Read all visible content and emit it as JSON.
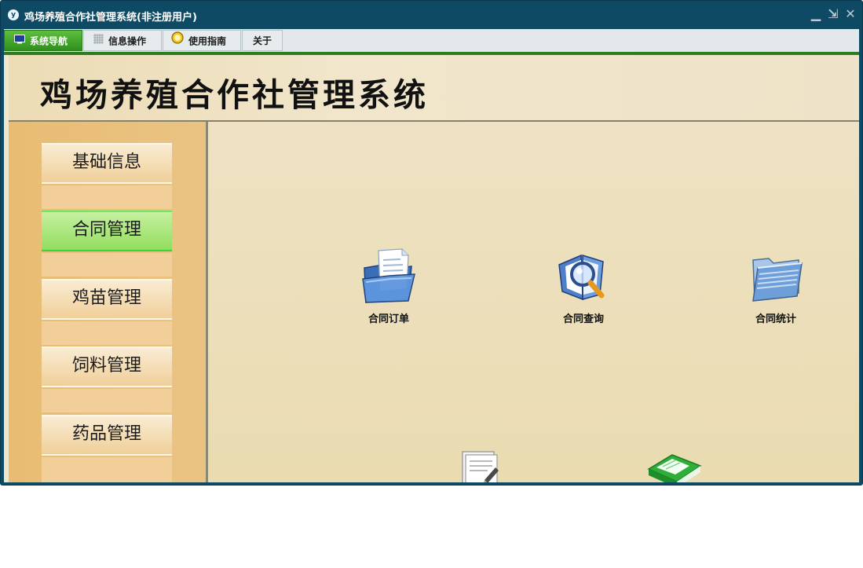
{
  "window": {
    "title": "鸡场养殖合作社管理系统(非注册用户)",
    "app_icon_text": "y",
    "controls": {
      "minimize": "▁",
      "restore": "⇲",
      "close": "✕"
    }
  },
  "menu": {
    "tabs": [
      {
        "label": "系统导航",
        "icon": "monitor-icon",
        "active": true
      },
      {
        "label": "信息操作",
        "icon": "grid-icon",
        "active": false
      },
      {
        "label": "使用指南",
        "icon": "compass-icon",
        "active": false
      },
      {
        "label": "关于",
        "icon": "",
        "active": false
      }
    ]
  },
  "banner": {
    "title": "鸡场养殖合作社管理系统"
  },
  "sidebar": {
    "items": [
      {
        "label": "基础信息",
        "active": false
      },
      {
        "label": "合同管理",
        "active": true
      },
      {
        "label": "鸡苗管理",
        "active": false
      },
      {
        "label": "饲料管理",
        "active": false
      },
      {
        "label": "药品管理",
        "active": false
      }
    ]
  },
  "main": {
    "icons": [
      {
        "label": "合同订单",
        "icon": "document-folder-icon"
      },
      {
        "label": "合同查询",
        "icon": "magnifier-book-icon"
      },
      {
        "label": "合同统计",
        "icon": "folder-icon"
      },
      {
        "label": "",
        "icon": "edit-document-icon"
      },
      {
        "label": "",
        "icon": "green-book-icon"
      }
    ]
  },
  "colors": {
    "titlebar": "#0f4a64",
    "active_tab": "#3d9d27",
    "sidebar": "#e8bc72",
    "active_side_item": "#a8e47c",
    "content_bg": "#eee2c4"
  }
}
